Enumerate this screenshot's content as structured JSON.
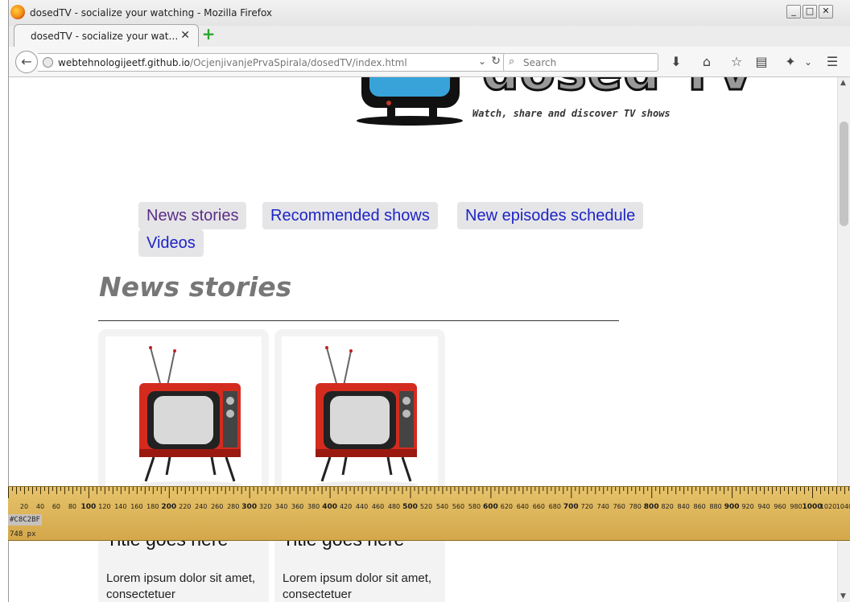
{
  "window": {
    "title": "dosedTV - socialize your watching - Mozilla Firefox",
    "tab_title": "dosedTV - socialize your wat…",
    "close_tab": "✕",
    "new_tab": "+"
  },
  "toolbar": {
    "url_host": "webtehnologijeetf.github.io",
    "url_path": "/OcjenjivanjePrvaSpirala/dosedTV/index.html",
    "search_placeholder": "Search"
  },
  "site": {
    "logo_text": "dosed TV",
    "tagline": "Watch, share and discover TV shows",
    "nav": [
      {
        "label": "News stories",
        "active": true
      },
      {
        "label": "Recommended shows",
        "active": false
      },
      {
        "label": "New episodes schedule",
        "active": false
      },
      {
        "label": "Videos",
        "active": false
      }
    ],
    "section_title": "News stories",
    "cards": [
      {
        "title": "Title goes here",
        "text": "Lorem ipsum dolor sit amet, consectetuer"
      },
      {
        "title": "Title goes here",
        "text": "Lorem ipsum dolor sit amet, consectetuer"
      }
    ]
  },
  "ruler": {
    "labels": [
      "20",
      "40",
      "60",
      "80",
      "100",
      "120",
      "140",
      "160",
      "180",
      "200",
      "220",
      "240",
      "260",
      "280",
      "300",
      "320",
      "340",
      "360",
      "380",
      "400",
      "420",
      "440",
      "460",
      "480",
      "500",
      "520",
      "540",
      "560",
      "580",
      "600",
      "620",
      "640",
      "660",
      "680",
      "700",
      "720",
      "740",
      "760",
      "780",
      "800",
      "820",
      "840",
      "860",
      "880",
      "900",
      "920",
      "940",
      "960",
      "980",
      "1000",
      "1020",
      "1040"
    ],
    "color_readout": "#C8C2BF",
    "size_readout": "748 px"
  },
  "colors": {
    "nav_link": "#1d24c4",
    "nav_active": "#5b2f86",
    "ruler": "#ddb55a"
  }
}
